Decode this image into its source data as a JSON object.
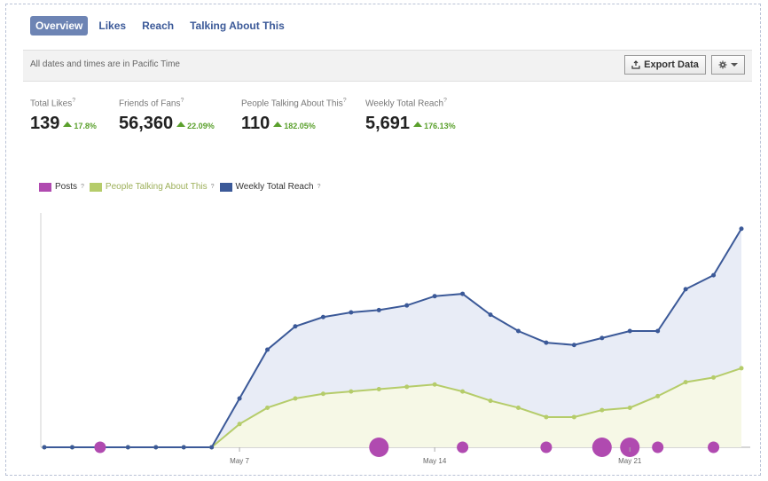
{
  "tabs": [
    {
      "label": "Overview",
      "active": true
    },
    {
      "label": "Likes",
      "active": false
    },
    {
      "label": "Reach",
      "active": false
    },
    {
      "label": "Talking About This",
      "active": false
    }
  ],
  "infobar": {
    "note": "All dates and times are in Pacific Time",
    "export_label": "Export Data",
    "export_icon": "export-icon",
    "gear_icon": "gear-icon"
  },
  "metrics": [
    {
      "label": "Total Likes",
      "help": "?",
      "value": "139",
      "change": "17.8%"
    },
    {
      "label": "Friends of Fans",
      "help": "?",
      "value": "56,360",
      "change": "22.09%"
    },
    {
      "label": "People Talking About This",
      "help": "?",
      "value": "110",
      "change": "182.05%"
    },
    {
      "label": "Weekly Total Reach",
      "help": "?",
      "value": "5,691",
      "change": "176.13%"
    }
  ],
  "legend": [
    {
      "label": "Posts",
      "help": "?",
      "color": "#b04ab0"
    },
    {
      "label": "People Talking About This",
      "help": "?",
      "color": "#b5cc6a"
    },
    {
      "label": "Weekly Total Reach",
      "help": "?",
      "color": "#3b5998"
    }
  ],
  "colors": {
    "accent": "#3b5998",
    "active_tab_bg": "#6d84b4",
    "positive": "#5aa02c",
    "reach_fill": "#e8ecf6",
    "talking_fill": "#f6f8e6"
  },
  "chart_data": {
    "type": "line",
    "x_ticks": [
      "May 7",
      "May 14",
      "May 21"
    ],
    "x_tick_index": [
      7,
      14,
      21
    ],
    "y_range": [
      0,
      100
    ],
    "series": [
      {
        "name": "Weekly Total Reach",
        "values": [
          0,
          0,
          0,
          0,
          0,
          0,
          0,
          21,
          42,
          52,
          56,
          58,
          59,
          61,
          65,
          66,
          57,
          50,
          45,
          44,
          47,
          50,
          50,
          68,
          74,
          94
        ]
      },
      {
        "name": "People Talking About This",
        "values": [
          0,
          0,
          0,
          0,
          0,
          0,
          0,
          10,
          17,
          21,
          23,
          24,
          25,
          26,
          27,
          24,
          20,
          17,
          13,
          13,
          16,
          17,
          22,
          28,
          30,
          34
        ]
      },
      {
        "name": "Posts",
        "bubbles": [
          {
            "x": 2,
            "size": 1
          },
          {
            "x": 12,
            "size": 2
          },
          {
            "x": 15,
            "size": 1
          },
          {
            "x": 18,
            "size": 1
          },
          {
            "x": 20,
            "size": 2
          },
          {
            "x": 21,
            "size": 2
          },
          {
            "x": 22,
            "size": 1
          },
          {
            "x": 24,
            "size": 1
          }
        ]
      }
    ]
  }
}
